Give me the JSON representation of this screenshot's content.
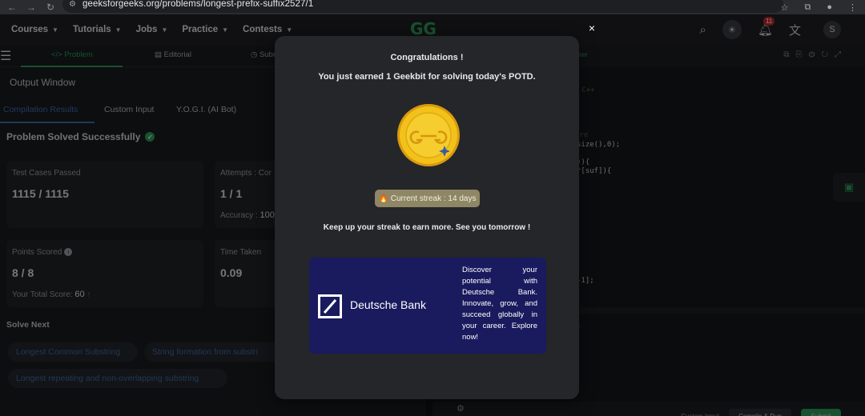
{
  "browser": {
    "url": "geeksforgeeks.org/problems/longest-prefix-suffix2527/1"
  },
  "header": {
    "menu": [
      {
        "label": "Courses"
      },
      {
        "label": "Tutorials"
      },
      {
        "label": "Jobs"
      },
      {
        "label": "Practice"
      },
      {
        "label": "Contests"
      }
    ],
    "logo": "GG",
    "notification_count": "11",
    "avatar_letter": "S"
  },
  "problem_tabs": {
    "problem": "</> Problem",
    "editorial": "Editorial",
    "submissions": "Subm"
  },
  "output": {
    "title": "Output Window",
    "tabs": [
      "Compilation Results",
      "Custom Input",
      "Y.O.G.I. (AI Bot)"
    ],
    "status": "Problem Solved Successfully",
    "cards": {
      "test_cases": {
        "label": "Test Cases Passed",
        "value": "1115 / 1115"
      },
      "attempts": {
        "label": "Attempts : Cor",
        "value": "1 / 1",
        "extra_label": "Accuracy :",
        "extra_value": "100"
      },
      "points": {
        "label": "Points Scored",
        "value": "8 / 8",
        "extra_label": "Your Total Score:",
        "extra_value": "60"
      },
      "time": {
        "label": "Time Taken",
        "value": "0.09"
      }
    },
    "solve_next": {
      "title": "Solve Next",
      "items": [
        "Longest Common Substring",
        "String formation from substri",
        "Longest repeating and non-overlapping substring"
      ]
    }
  },
  "editor": {
    "timer_label": "imer",
    "lines": [
      {
        "text": "or C++",
        "kind": "comment"
      },
      {
        "text": "ere",
        "kind": "comment"
      },
      {
        "text": "size(),0);",
        "kind": "code"
      },
      {
        "text": ")){",
        "kind": "code"
      },
      {
        "text": "r[suf]){",
        "kind": "code"
      },
      {
        "text": "-1];",
        "kind": "code"
      },
      {
        "text": ";",
        "kind": "code"
      }
    ],
    "bottom_buttons": [
      "Custom Input",
      "Compile & Run",
      "Submit"
    ]
  },
  "modal": {
    "title": "Congratulations !",
    "subtitle": "You just earned 1 Geekbit for solving today's POTD.",
    "coin_icon": "geekbit-coin-icon",
    "streak": "🔥 Current streak : 14 days",
    "encouragement": "Keep up your streak to earn more. See you tomorrow !",
    "ad": {
      "brand": "Deutsche Bank",
      "text": "Discover your potential with Deutsche Bank. Innovate, grow, and succeed globally in your career. Explore now!"
    },
    "close_label": "×"
  },
  "colors": {
    "accent_green": "#2f9e5c",
    "link_blue": "#3f6eb8",
    "coin_gold": "#f2c21b",
    "ad_background": "#1a1a5e",
    "streak_background": "#8e8664"
  }
}
